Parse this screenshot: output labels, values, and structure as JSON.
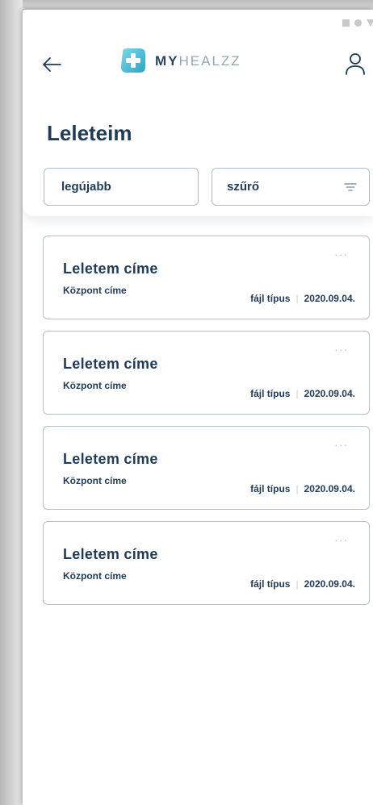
{
  "app": {
    "logo_my": "MY",
    "logo_rest": "HEALZZ"
  },
  "header": {
    "back_icon": "arrow-left-icon",
    "user_icon": "user-icon",
    "title": "Leleteim"
  },
  "controls": {
    "sort_label": "legújabb",
    "filter_label": "szűrő",
    "filter_icon": "filter-lines-icon"
  },
  "colors": {
    "primary_text": "#1f3b57",
    "logo_teal": "#4ec3d9",
    "border": "#b4c1cb"
  },
  "results": [
    {
      "title": "Leletem címe",
      "subtitle": "Központ címe",
      "file_type": "fájl típus",
      "separator": "|",
      "date": "2020.09.04.",
      "menu": "···"
    },
    {
      "title": "Leletem címe",
      "subtitle": "Központ címe",
      "file_type": "fájl típus",
      "separator": "|",
      "date": "2020.09.04.",
      "menu": "···"
    },
    {
      "title": "Leletem címe",
      "subtitle": "Központ címe",
      "file_type": "fájl típus",
      "separator": "|",
      "date": "2020.09.04.",
      "menu": "···"
    },
    {
      "title": "Leletem címe",
      "subtitle": "Központ címe",
      "file_type": "fájl típus",
      "separator": "|",
      "date": "2020.09.04.",
      "menu": "···"
    }
  ]
}
